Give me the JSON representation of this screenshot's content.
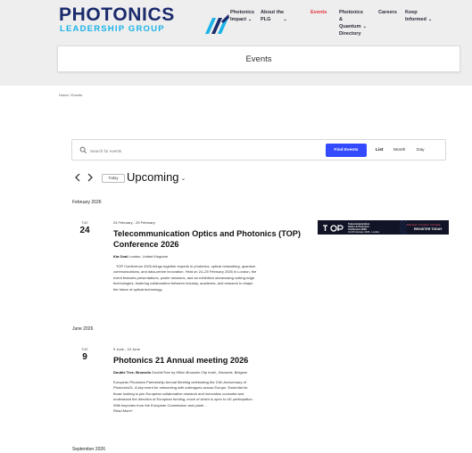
{
  "header": {
    "logo_main": "PHOTONICS",
    "logo_sub": "LEADERSHIP GROUP",
    "nav": [
      {
        "line1": "Photonics",
        "line2": "Impact",
        "chevron": "⌄",
        "active": false
      },
      {
        "line1": "About the",
        "line2": "PLG",
        "chevron": "⌄",
        "active": false
      },
      {
        "line1": "Events",
        "line2": "",
        "chevron": "",
        "active": true
      },
      {
        "line1": "Photonics &",
        "line2": "Quantum",
        "line3": "Directory",
        "chevron": "⌄",
        "active": false
      },
      {
        "line1": "Careers",
        "line2": "",
        "chevron": "",
        "active": false
      },
      {
        "line1": "Keep",
        "line2": "Informed",
        "chevron": "⌄",
        "active": false
      }
    ],
    "page_title": "Events"
  },
  "breadcrumb": "Home  /  Events",
  "search": {
    "placeholder": "Search for events",
    "button": "Find Events",
    "views": [
      "List",
      "Month",
      "Day"
    ],
    "active_view": "List"
  },
  "navrow": {
    "today": "Today",
    "upcoming": "Upcoming",
    "upcoming_chevron": "⌄"
  },
  "months": [
    "February 2026",
    "June 2026",
    "September 2026"
  ],
  "events": [
    {
      "dow": "TUE",
      "day": "24",
      "datetime": "24 February - 25 February",
      "title_line1": "Telecommunication Optics and Photonics (TOP)",
      "title_line2": "Conference 2026",
      "venue_name": "Kia Oval",
      "venue_addr": "London, United Kingdom",
      "desc": [
        "TOP Conference 2026 brings together experts in photonics, optical networking, quantum",
        "communications, and data-centre innovation. Held on 24–25 February 2026 in London, the",
        "event features presentations, poster sessions, and an exhibition showcasing cutting-edge",
        "technologies, fostering collaboration between industry, academia, and research to shape",
        "the future of optical technology."
      ]
    },
    {
      "dow": "TUE",
      "day": "9",
      "datetime": "9 June - 10 June",
      "title_line1": "Photonics 21 Annual meeting 2026",
      "venue_name": "Double Tree, Brussels",
      "venue_addr": "DoubleTree by Hilton Brussels City hotel,, Brussels, Belgium",
      "desc": [
        "European Photonics Partnership Annual Meeting celebrating the 21th Anniversary of",
        "Photonics21. A key event for networking with colleagues across Europe. Essential for",
        "those looking to join European collaborative research and innovation consortia and",
        "understand the direction of European funding, much of which is open to UK participation.",
        "With keynotes from the European Commission and panel…",
        "Read More+"
      ]
    }
  ],
  "banner": {
    "org_line1": "Telecommunication",
    "org_line2": "Optics & Photonics",
    "org_line3": "Conference 2026",
    "org_line4": "24-25 February 2026 - London",
    "tagline": "Discover. Connect. Innovate.",
    "cta": "REGISTER TODAY"
  },
  "colors": {
    "brand_navy": "#1a2a6c",
    "brand_cyan": "#1bb3e8",
    "accent_red": "#e6323e",
    "button_blue": "#334aff"
  }
}
